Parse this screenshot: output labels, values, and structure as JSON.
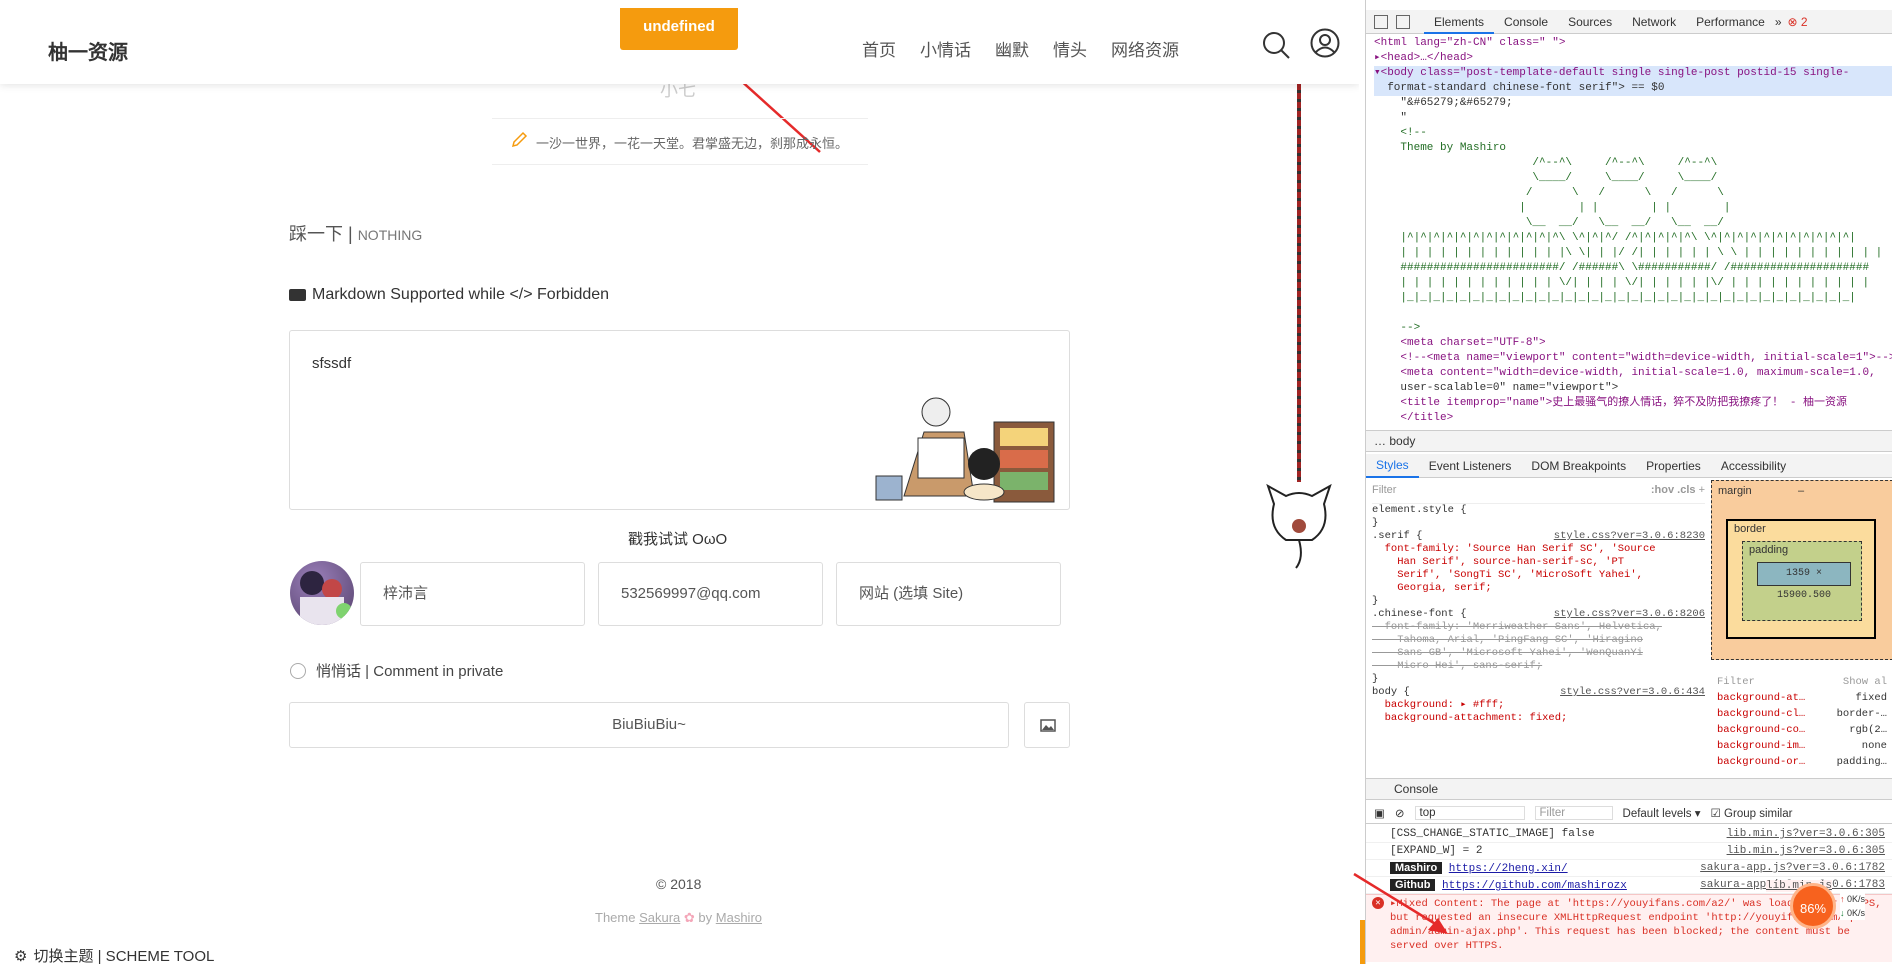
{
  "site": {
    "logo": "柚一资源",
    "nav": [
      "首页",
      "小情话",
      "幽默",
      "情头",
      "网络资源"
    ],
    "toast": "undefined",
    "ghost_author": "小七",
    "motto": "一沙一世界，一花一天堂。君掌盛无边，刹那成永恒。",
    "step_main": "踩一下 | ",
    "step_sub": "NOTHING",
    "markdown_note": "Markdown Supported while </> Forbidden",
    "comment_text": "sfssdf",
    "poke": "戳我试试 OωO",
    "name_value": "梓沛言",
    "email_value": "532569997@qq.com",
    "site_placeholder": "网站 (选填 Site)",
    "private_label": "悄悄话 | Comment in private",
    "submit_label": "BiuBiuBiu~",
    "footer_copy": "© 2018",
    "footer_theme_prefix": "Theme ",
    "footer_theme_name": "Sakura",
    "footer_by": " by ",
    "footer_author": "Mashiro",
    "scheme_tool": "切换主题 | SCHEME TOOL",
    "accent": "#f59b0e"
  },
  "devtools": {
    "tabs": [
      "Elements",
      "Console",
      "Sources",
      "Network",
      "Performance"
    ],
    "error_count": "2",
    "elements_lines": [
      "<html lang=\"zh-CN\" class=\" \">",
      "▸<head>…</head>",
      "▾<body class=\"post-template-default single single-post postid-15 single-",
      "  format-standard chinese-font serif\"> == $0",
      "    \"&#65279;&#65279;",
      "    \"",
      "    <!--",
      "    Theme by Mashiro",
      "                        /^--^\\     /^--^\\     /^--^\\",
      "                        \\____/     \\____/     \\____/",
      "                       /      \\   /      \\   /      \\",
      "                      |        | |        | |        |",
      "                       \\__  __/   \\__  __/   \\__  __/",
      "    |^|^|^|^|^|^|^|^|^|^|^|^\\ \\^|^|^/ /^|^|^|^|^\\ \\^|^|^|^|^|^|^|^|^|^|^|",
      "    | | | | | | | | | | | | |\\ \\| | |/ /| | | | | | \\ \\ | | | | | | | | | | |",
      "    ########################/ /######\\ \\###########/ /#####################",
      "    | | | | | | | | | | | | \\/| | | | \\/| | | | | |\\/ | | | | | | | | | | |",
      "    |_|_|_|_|_|_|_|_|_|_|_|_|_|_|_|_|_|_|_|_|_|_|_|_|_|_|_|_|_|_|_|_|_|_|",
      "",
      "    -->",
      "    <meta charset=\"UTF-8\">",
      "    <!--<meta name=\"viewport\" content=\"width=device-width, initial-scale=1\">-->",
      "    <meta content=\"width=device-width, initial-scale=1.0, maximum-scale=1.0,",
      "    user-scalable=0\" name=\"viewport\">",
      "    <title itemprop=\"name\">史上最骚气的撩人情话，猝不及防把我撩疼了！ - 柚一资源",
      "    </title>"
    ],
    "breadcrumb": "body",
    "subtabs": [
      "Styles",
      "Event Listeners",
      "DOM Breakpoints",
      "Properties",
      "Accessibility"
    ],
    "styles_filter": "Filter",
    "styles_hov": ":hov",
    "styles_cls": ".cls",
    "styles_lines": [
      {
        "text": "element.style {",
        "src": ""
      },
      {
        "text": "}",
        "src": ""
      },
      {
        "text": ".serif {",
        "src": "style.css?ver=3.0.6:8230"
      },
      {
        "text": "  font-family: 'Source Han Serif SC', 'Source",
        "src": ""
      },
      {
        "text": "    Han Serif', source-han-serif-sc, 'PT",
        "src": ""
      },
      {
        "text": "    Serif', 'SongTi SC', 'MicroSoft Yahei',",
        "src": ""
      },
      {
        "text": "    Georgia, serif;",
        "src": ""
      },
      {
        "text": "}",
        "src": ""
      },
      {
        "text": ".chinese-font {",
        "src": "style.css?ver=3.0.6:8206"
      },
      {
        "text": "  font-family: 'Merriweather Sans', Helvetica,",
        "src": ""
      },
      {
        "text": "    Tahoma, Arial, 'PingFang SC', 'Hiragino",
        "src": ""
      },
      {
        "text": "    Sans GB', 'Microsoft Yahei', 'WenQuanYi",
        "src": ""
      },
      {
        "text": "    Micro Hei', sans-serif;",
        "src": ""
      },
      {
        "text": "}",
        "src": ""
      },
      {
        "text": "body {",
        "src": "style.css?ver=3.0.6:434"
      },
      {
        "text": "  background: ▸ #fff;",
        "src": ""
      },
      {
        "text": "  background-attachment: fixed;",
        "src": ""
      }
    ],
    "box_margin": "margin",
    "box_border": "border",
    "box_padding": "padding",
    "box_dash": "–",
    "box_content": "1359 × 15900.500",
    "computed_filter": "Filter",
    "computed_showall": "Show al",
    "computed_rows": [
      {
        "k": "background-at…",
        "v": "fixed"
      },
      {
        "k": "background-cl…",
        "v": "border-…"
      },
      {
        "k": "background-co…",
        "v": "rgb(2…"
      },
      {
        "k": "background-im…",
        "v": "none"
      },
      {
        "k": "background-or…",
        "v": "padding…"
      }
    ],
    "console_tab": "Console",
    "console_context": "top",
    "console_filter": "Filter",
    "console_levels": "Default levels ▾",
    "console_group": "Group similar",
    "console_lines": [
      {
        "text": "[CSS_CHANGE_STATIC_IMAGE] false",
        "src": "lib.min.js?ver=3.0.6:305"
      },
      {
        "text": "[EXPAND_W] = 2",
        "src": "lib.min.js?ver=3.0.6:305"
      }
    ],
    "badge1": "Mashiro",
    "badge1_link": "https://2heng.xin/",
    "badge1_src": "sakura-app.js?ver=3.0.6:1782",
    "badge2": "Github",
    "badge2_link": "https://github.com/mashirozx",
    "badge2_src": "sakura-app.js?ver=3.0.6:1783",
    "error_text": "▸Mixed Content: The page at 'https://youyifans.com/a2/' was loaded over HTTPS, but requested an insecure XMLHttpRequest endpoint 'http://youyifans.com/wp-admin/admin-ajax.php'. This request has been blocked; the content must be served over HTTPS.",
    "error_src": "lib.min.js",
    "net_percent": "86%",
    "net_up": "0K/s",
    "net_down": "0K/s"
  }
}
